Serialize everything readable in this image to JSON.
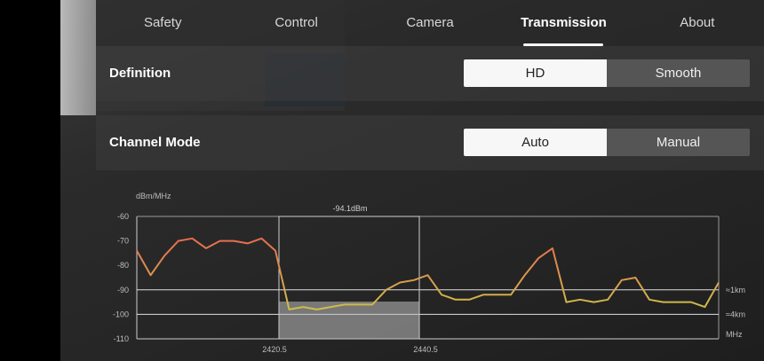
{
  "tabs": [
    {
      "label": "Safety",
      "active": false
    },
    {
      "label": "Control",
      "active": false
    },
    {
      "label": "Camera",
      "active": false
    },
    {
      "label": "Transmission",
      "active": true
    },
    {
      "label": "About",
      "active": false
    }
  ],
  "definition": {
    "label": "Definition",
    "options": [
      "HD",
      "Smooth"
    ],
    "selected": "HD"
  },
  "channel_mode": {
    "label": "Channel Mode",
    "options": [
      "Auto",
      "Manual"
    ],
    "selected": "Auto"
  },
  "chart_data": {
    "type": "line",
    "ylabel": "dBm/MHz",
    "xunit": "MHz",
    "ylim": [
      -110,
      -60
    ],
    "yticks": [
      -60,
      -70,
      -80,
      -90,
      -100,
      -110
    ],
    "xticks": [
      "2420.5",
      "2440.5"
    ],
    "selection_label": "-94.1dBm",
    "ref_labels": [
      "≈1km",
      "≈4km"
    ],
    "series": [
      {
        "values": [
          -74,
          -84,
          -76,
          -70,
          -69,
          -73,
          -70,
          -70,
          -71,
          -69,
          -74,
          -98,
          -97,
          -98,
          -97,
          -96,
          -96,
          -96,
          -90,
          -87,
          -86,
          -84,
          -92,
          -94,
          -94,
          -92,
          -92,
          -92,
          -84,
          -77,
          -73,
          -95,
          -94,
          -95,
          -94,
          -86,
          -85,
          -94,
          -95,
          -95,
          -95,
          -97,
          -87
        ]
      }
    ],
    "colors": {
      "high": "#e8684f",
      "low": "#cdbf4a"
    }
  }
}
